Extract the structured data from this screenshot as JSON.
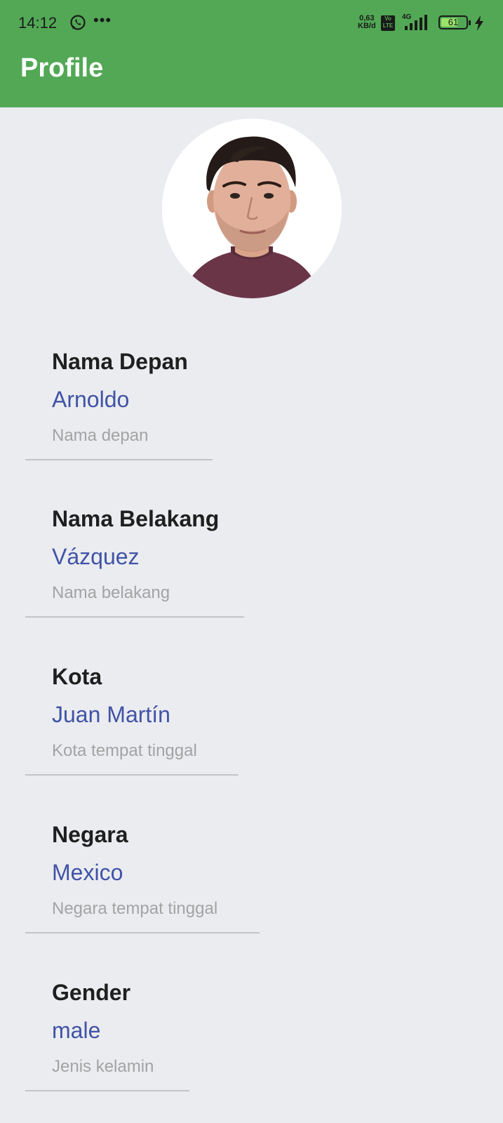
{
  "status_bar": {
    "time": "14:12",
    "net_speed_value": "0,63",
    "net_speed_unit": "KB/d",
    "volte_top": "Vo",
    "volte_bottom": "LTE",
    "network_type": "4G",
    "battery_level": "61",
    "icons": [
      "whatsapp-icon",
      "more-dots-icon",
      "volte-icon",
      "signal-icon",
      "battery-icon",
      "charging-bolt-icon"
    ]
  },
  "app_bar": {
    "title": "Profile",
    "color": "#52a855"
  },
  "profile": {
    "fields": [
      {
        "label": "Nama Depan",
        "value": "Arnoldo",
        "hint": "Nama depan"
      },
      {
        "label": "Nama Belakang",
        "value": "Vázquez",
        "hint": "Nama belakang"
      },
      {
        "label": "Kota",
        "value": "Juan Martín",
        "hint": "Kota tempat tinggal"
      },
      {
        "label": "Negara",
        "value": "Mexico",
        "hint": "Negara tempat tinggal"
      },
      {
        "label": "Gender",
        "value": "male",
        "hint": "Jenis kelamin"
      }
    ],
    "value_color": "#4153a6"
  }
}
